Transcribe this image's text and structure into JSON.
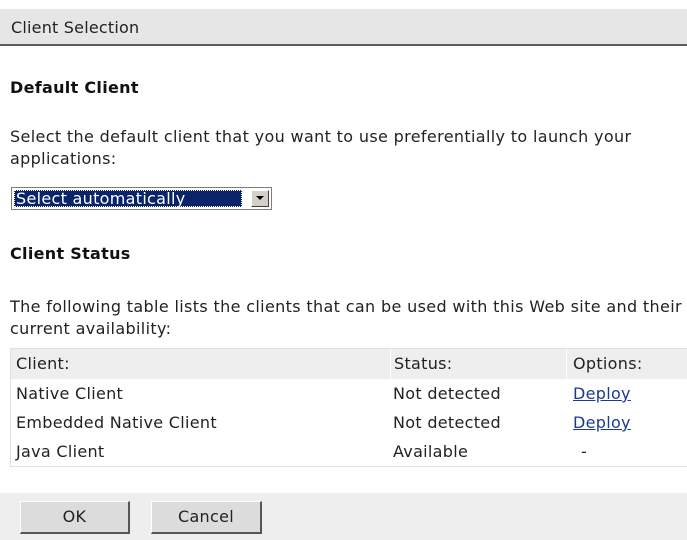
{
  "header": {
    "title": "Client Selection"
  },
  "default_client": {
    "heading": "Default Client",
    "description": "Select the default client that you want to use preferentially to launch your applications:",
    "select": {
      "selected": "Select automatically"
    }
  },
  "client_status": {
    "heading": "Client Status",
    "description": "The following table lists the clients that can be used with this Web site and their current availability:",
    "table": {
      "columns": [
        "Client:",
        "Status:",
        "Options:"
      ],
      "rows": [
        {
          "client": "Native Client",
          "status": "Not detected",
          "option": "Deploy"
        },
        {
          "client": "Embedded Native Client",
          "status": "Not detected",
          "option": "Deploy"
        },
        {
          "client": "Java Client",
          "status": "Available",
          "option": "-"
        }
      ]
    }
  },
  "footer": {
    "ok_label": "OK",
    "cancel_label": "Cancel"
  },
  "colors": {
    "header_bg": "#e6e6e6",
    "selection_bg": "#0a246a",
    "link": "#1a3a8e",
    "footer_bg": "#eeeeee"
  }
}
